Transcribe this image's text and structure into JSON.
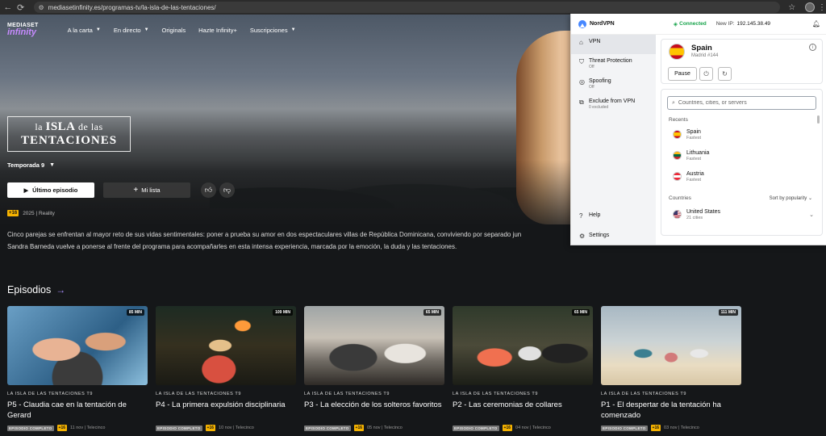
{
  "browser": {
    "url": "mediasetinfinity.es/programas-tv/la-isla-de-las-tentaciones/"
  },
  "site": {
    "logo_top": "MEDIASET",
    "logo_bottom": "infinity",
    "nav": [
      {
        "label": "A la carta",
        "has_dropdown": true
      },
      {
        "label": "En directo",
        "has_dropdown": true
      },
      {
        "label": "Originals",
        "has_dropdown": false
      },
      {
        "label": "Hazte Infinity+",
        "has_dropdown": false
      },
      {
        "label": "Suscripciones",
        "has_dropdown": true
      }
    ],
    "show_title_line1_pre": "la",
    "show_title_line1_big": "ISLA",
    "show_title_line1_post": "de las",
    "show_title_line2": "TENTACIONES",
    "season": "Temporada 9",
    "play_button": "Último episodio",
    "list_button": "Mi lista",
    "age": "+16",
    "meta": "2025 | Reality",
    "description_1": "Cinco parejas se enfrentan al mayor reto de sus vidas sentimentales: poner a prueba su amor en dos espectaculares villas de República Dominicana, conviviendo por separado jun",
    "description_2": "Sandra Barneda vuelve a ponerse al frente del programa para acompañarles en esta intensa experiencia, marcada por la emoción, la duda y las tentaciones.",
    "episodes_heading": "Episodios",
    "episodes": [
      {
        "duration": "85 MIN",
        "show": "LA ISLA DE LAS TENTACIONES T9",
        "title": "P5 - Claudia cae en la tentación de Gerard",
        "tag": "EPISODIO COMPLETO",
        "age": "+16",
        "meta": "11 nov | Telecinco"
      },
      {
        "duration": "109 MIN",
        "show": "LA ISLA DE LAS TENTACIONES T9",
        "title": "P4 - La primera expulsión disciplinaria",
        "tag": "EPISODIO COMPLETO",
        "age": "+16",
        "meta": "10 nov | Telecinco"
      },
      {
        "duration": "65 MIN",
        "show": "LA ISLA DE LAS TENTACIONES T9",
        "title": "P3 - La elección de los solteros favoritos",
        "tag": "EPISODIO COMPLETO",
        "age": "+16",
        "meta": "05 nov | Telecinco"
      },
      {
        "duration": "65 MIN",
        "show": "LA ISLA DE LAS TENTACIONES T9",
        "title": "P2 - Las ceremonias de collares",
        "tag": "EPISODIO COMPLETO",
        "age": "+16",
        "meta": "04 nov | Telecinco"
      },
      {
        "duration": "111 MIN",
        "show": "LA ISLA DE LAS TENTACIONES T9",
        "title": "P1 - El despertar de la tentación ha comenzado",
        "tag": "EPISODIO COMPLETO",
        "age": "+16",
        "meta": "03 nov | Telecinco"
      }
    ]
  },
  "vpn": {
    "brand": "NordVPN",
    "status": "Connected",
    "ip_label": "New IP:",
    "ip": "192.145.38.49",
    "sidebar": [
      {
        "label": "VPN",
        "sub": "",
        "icon": "home-icon"
      },
      {
        "label": "Threat Protection",
        "sub": "Off",
        "icon": "shield-icon"
      },
      {
        "label": "Spoofing",
        "sub": "Off",
        "icon": "spoofing-icon"
      },
      {
        "label": "Exclude from VPN",
        "sub": "0 excluded",
        "icon": "split-tunnel-icon"
      }
    ],
    "help": "Help",
    "settings": "Settings",
    "location": {
      "country": "Spain",
      "server": "Madrid #144"
    },
    "pause": "Pause",
    "search_placeholder": "Countries, cities, or servers",
    "recents_label": "Recents",
    "recents": [
      {
        "name": "Spain",
        "sub": "Fastest"
      },
      {
        "name": "Lithuania",
        "sub": "Fastest"
      },
      {
        "name": "Austria",
        "sub": "Fastest"
      }
    ],
    "countries_label": "Countries",
    "sort_label": "Sort by popularity",
    "countries": [
      {
        "name": "United States",
        "sub": "21 cities"
      }
    ],
    "colors": {
      "connected": "#16a34a",
      "accent": "#4687ff"
    }
  }
}
